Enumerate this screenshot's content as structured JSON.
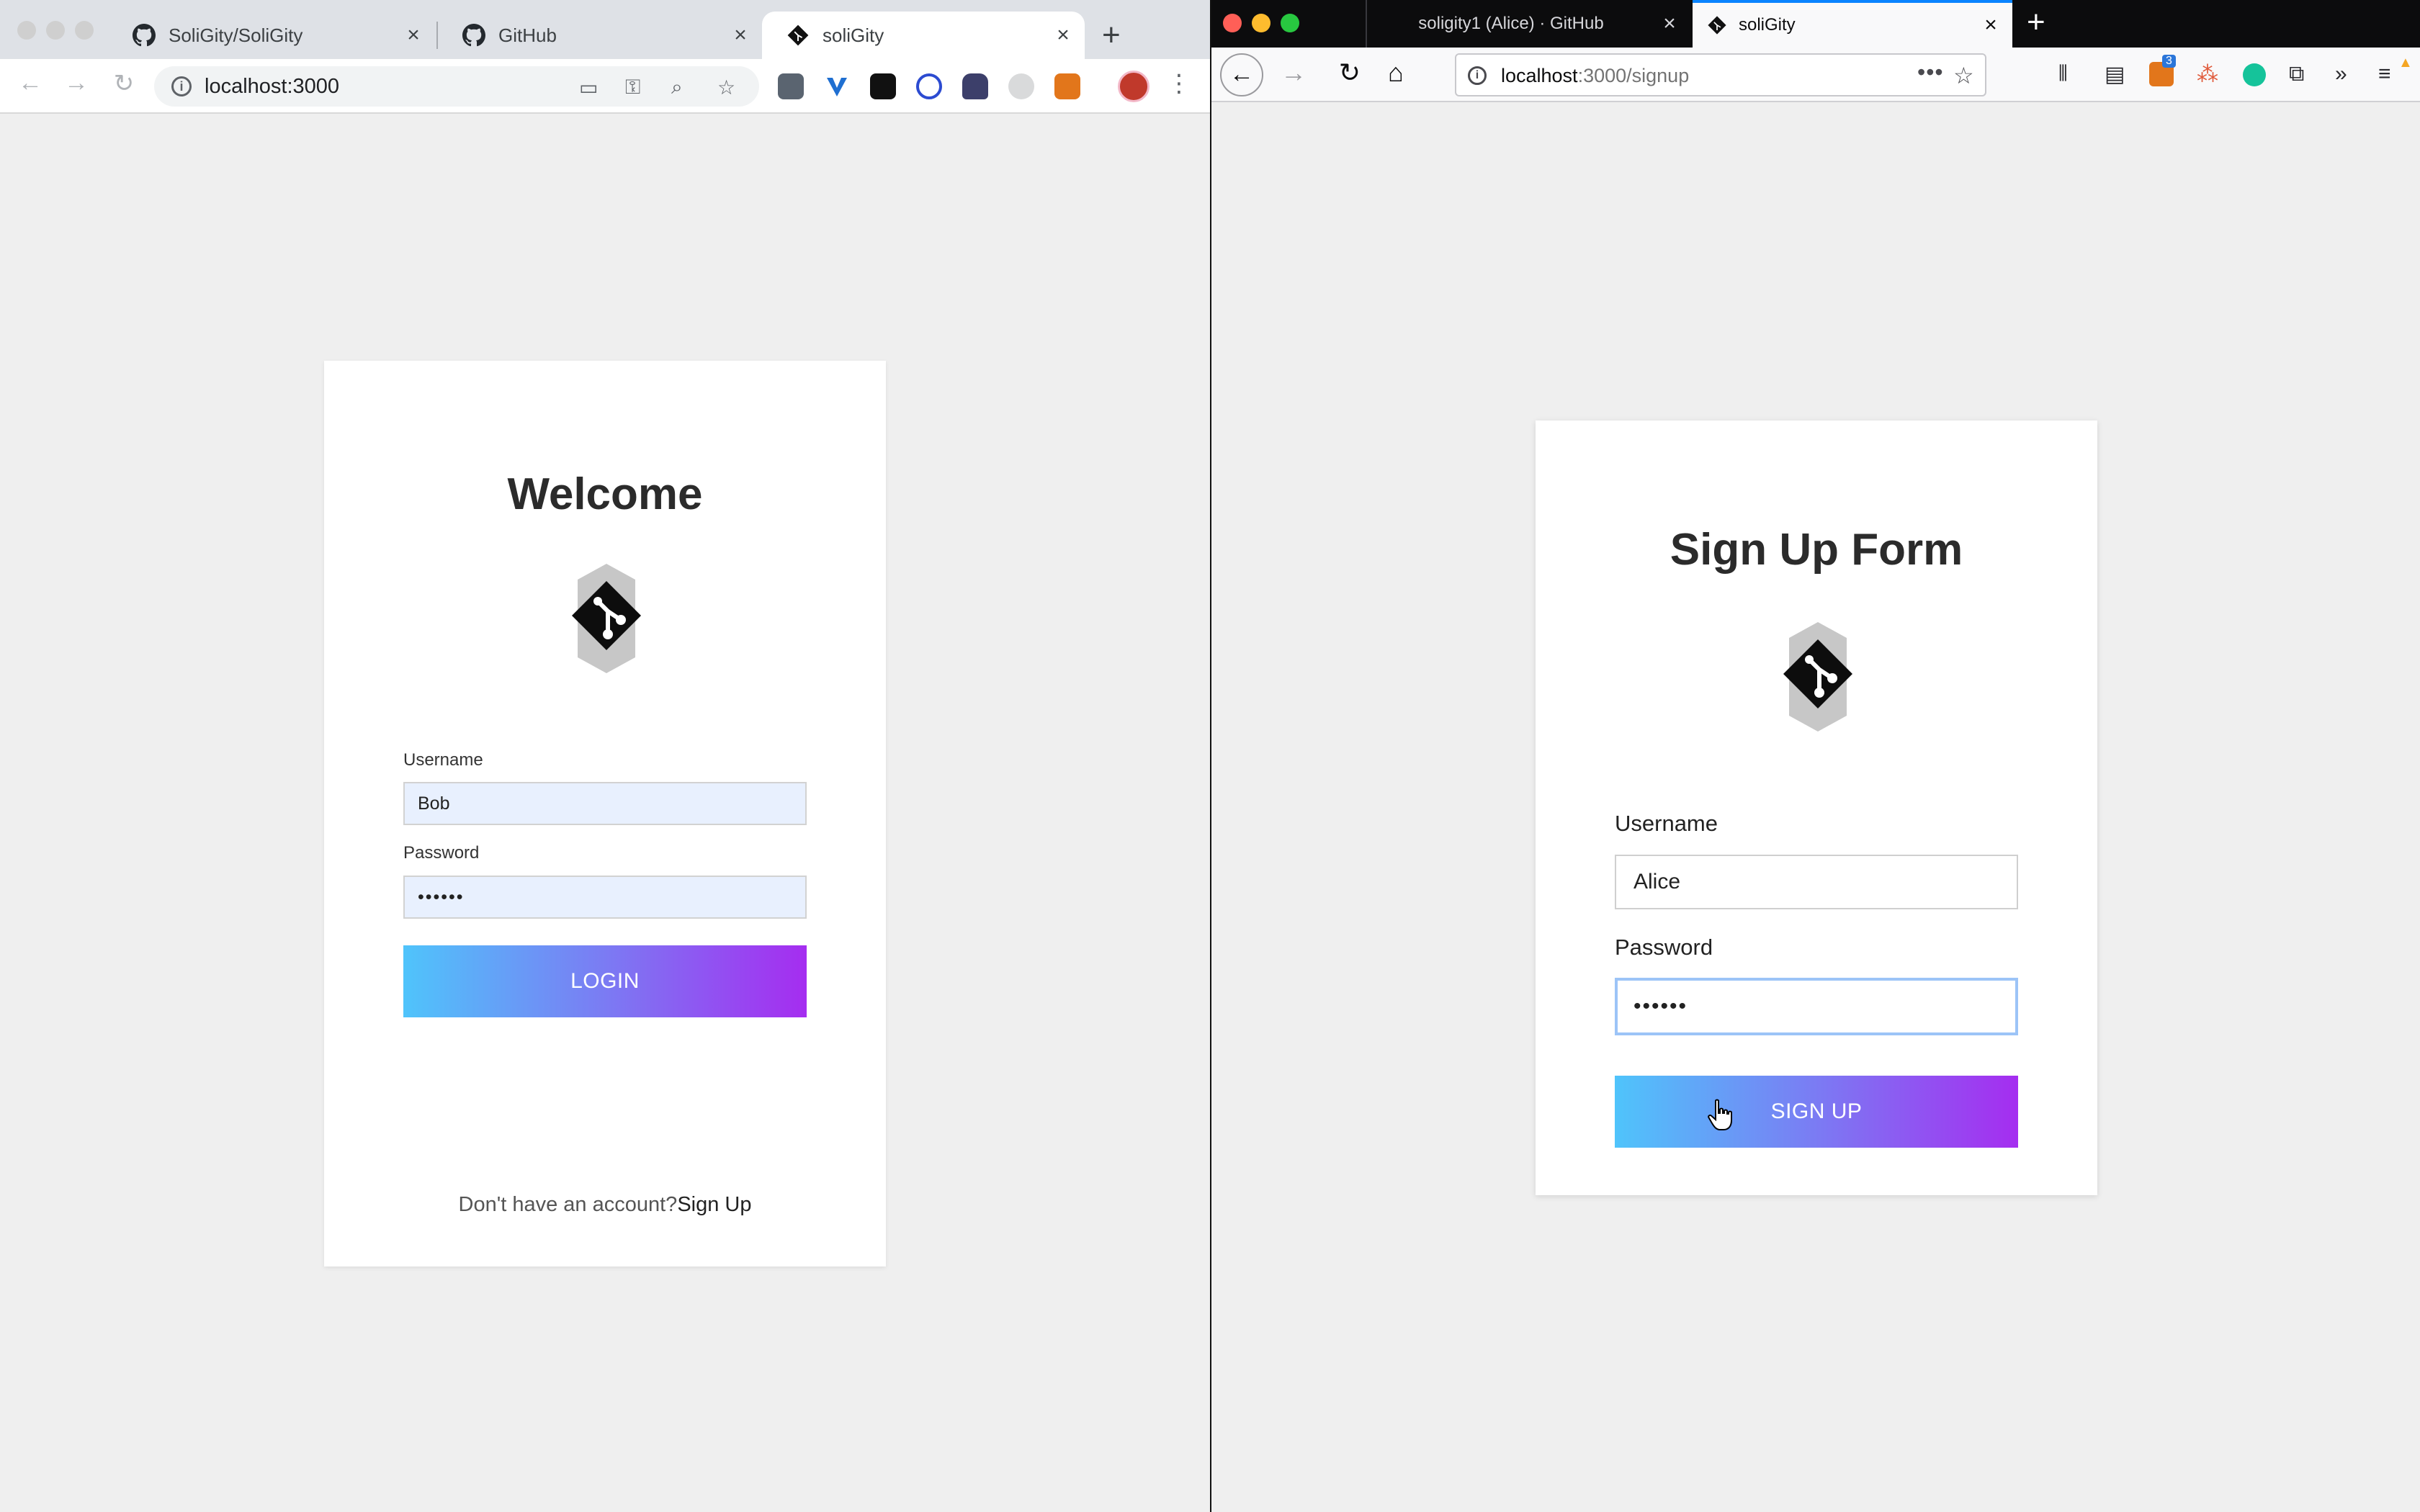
{
  "left_window": {
    "tabs": [
      {
        "title": "SoliGity/SoliGity"
      },
      {
        "title": "GitHub"
      },
      {
        "title": "soliGity"
      }
    ],
    "address_bar": {
      "url": "localhost:3000"
    },
    "login_form": {
      "heading": "Welcome",
      "username_label": "Username",
      "username_value": "Bob",
      "password_label": "Password",
      "password_value": "••••••",
      "login_button": "LOGIN",
      "signup_prompt": "Don't have an account?",
      "signup_link": "Sign Up"
    }
  },
  "right_window": {
    "tabs": [
      {
        "title": "soligity1 (Alice) · GitHub"
      },
      {
        "title": "soliGity"
      }
    ],
    "address_bar": {
      "host": "localhost",
      "path": ":3000/signup"
    },
    "extension_badge": "3",
    "signup_form": {
      "heading": "Sign Up Form",
      "username_label": "Username",
      "username_value": "Alice",
      "password_label": "Password",
      "password_value": "••••••",
      "signup_button": "SIGN UP"
    }
  },
  "colors": {
    "button_gradient_start": "#4fc4fb",
    "button_gradient_end": "#a52df0",
    "autofill_background": "#e8f0fe",
    "focus_ring": "#9cc4f7",
    "firefox_accent": "#0a84ff"
  }
}
